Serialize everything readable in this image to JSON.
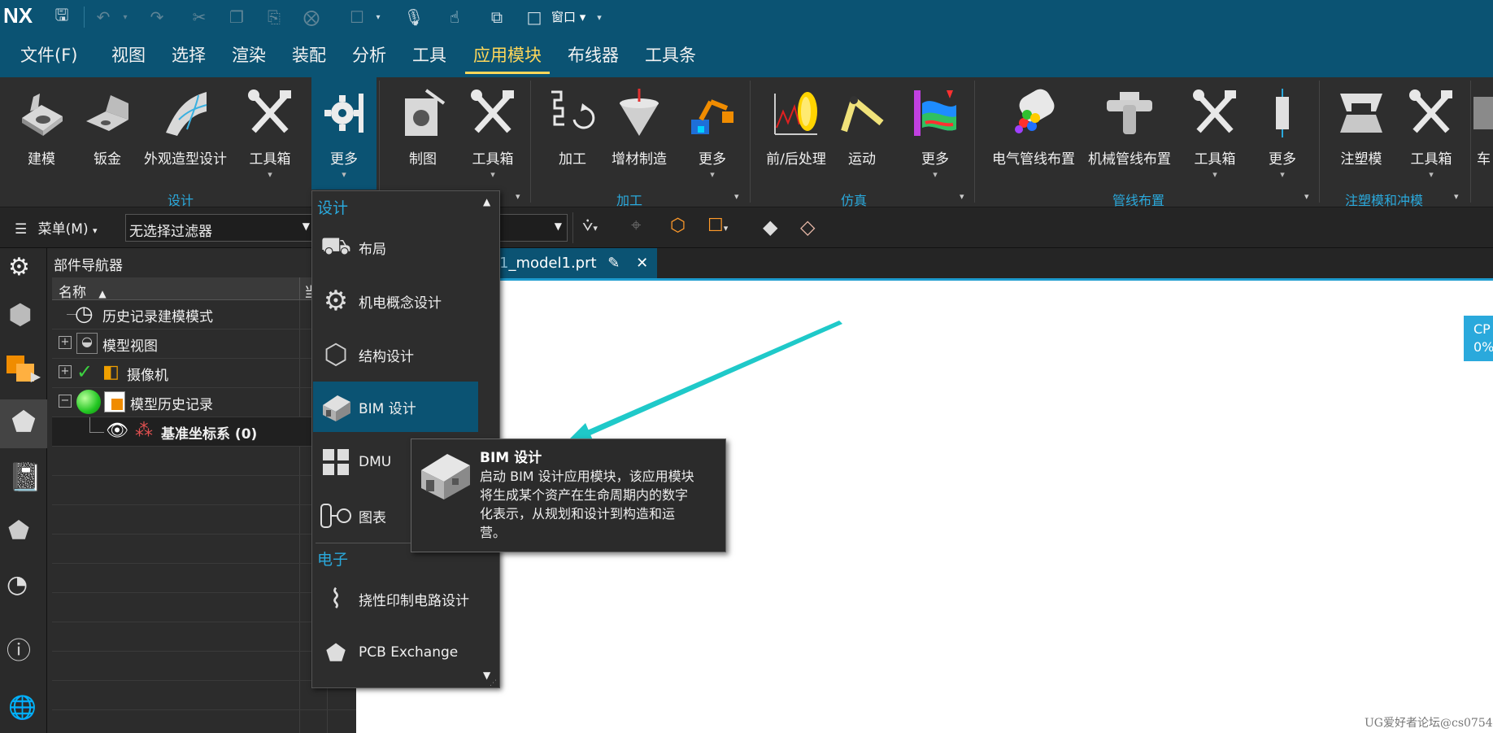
{
  "app": {
    "logo": "NX",
    "window_menu_label": "窗口"
  },
  "menubar": {
    "items": [
      "文件(F)",
      "视图",
      "选择",
      "渲染",
      "装配",
      "分析",
      "工具",
      "应用模块",
      "布线器",
      "工具条"
    ],
    "active": "应用模块"
  },
  "ribbon": {
    "buttons": [
      {
        "label": "建模"
      },
      {
        "label": "钣金"
      },
      {
        "label": "外观造型设计"
      },
      {
        "label": "工具箱"
      },
      {
        "label": "更多"
      },
      {
        "label": "制图"
      },
      {
        "label": "工具箱"
      },
      {
        "label": "加工"
      },
      {
        "label": "增材制造"
      },
      {
        "label": "更多"
      },
      {
        "label": "前/后处理"
      },
      {
        "label": "运动"
      },
      {
        "label": "更多"
      },
      {
        "label": "电气管线布置"
      },
      {
        "label": "机械管线布置"
      },
      {
        "label": "工具箱"
      },
      {
        "label": "更多"
      },
      {
        "label": "注塑模"
      },
      {
        "label": "工具箱"
      },
      {
        "label": "车"
      }
    ],
    "groups": [
      "设计",
      "加工",
      "仿真",
      "管线布置",
      "注塑模和冲模"
    ]
  },
  "toolbar2": {
    "menu_label": "菜单(M)",
    "filter_value": "无选择过滤器"
  },
  "navigator": {
    "title": "部件导航器",
    "col_name": "名称",
    "col_current": "当",
    "rows": [
      {
        "label": "历史记录建模模式"
      },
      {
        "label": "模型视图"
      },
      {
        "label": "摄像机"
      },
      {
        "label": "模型历史记录"
      },
      {
        "label": "基准坐标系 (0)"
      }
    ]
  },
  "document_tab": {
    "label": "_model1.prt",
    "prefix": "1"
  },
  "dropdown": {
    "section_design": "设计",
    "section_electronics": "电子",
    "items_design": [
      {
        "label": "布局"
      },
      {
        "label": "机电概念设计"
      },
      {
        "label": "结构设计"
      },
      {
        "label": "BIM 设计"
      },
      {
        "label": "DMU"
      },
      {
        "label": "图表"
      }
    ],
    "items_electronics": [
      {
        "label": "挠性印制电路设计"
      },
      {
        "label": "PCB Exchange"
      }
    ],
    "selected": "BIM 设计"
  },
  "tooltip": {
    "title": "BIM 设计",
    "lines": [
      "启动 BIM 设计应用模块，该应用模块",
      "将生成某个资产在生命周期内的数字",
      "化表示，从规划和设计到构造和运",
      "营。"
    ]
  },
  "cpu_badge": {
    "line1": "CP",
    "line2": "0%"
  },
  "watermark": "UG爱好者论坛@cs0754",
  "colors": {
    "titlebar": "#0b5373",
    "accent": "#2aa9dc",
    "active_menu": "#ffd75a",
    "arrow": "#1fc9c9"
  }
}
